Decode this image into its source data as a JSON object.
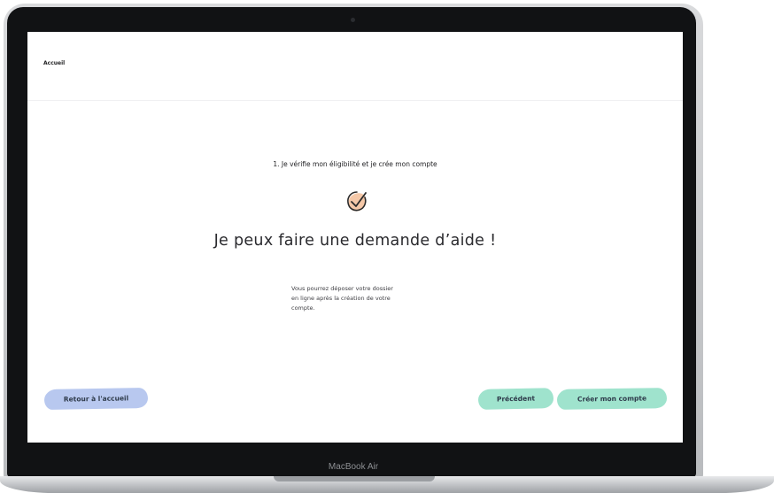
{
  "device": {
    "model_label": "MacBook Air"
  },
  "header": {
    "breadcrumb": "Accueil"
  },
  "step": {
    "label": "1. Je vérifie mon éligibilité et je crée mon compte"
  },
  "result": {
    "icon": "check-circle-icon",
    "headline": "Je peux faire une demande d’aide !",
    "description_lines": [
      "Vous pourrez déposer votre dossier",
      "en ligne après la création de votre",
      "compte."
    ]
  },
  "actions": {
    "back_label": "Retour à l'accueil",
    "previous_label": "Précédent",
    "create_label": "Créer mon compte"
  },
  "colors": {
    "back_button": "#b8c8ef",
    "primary_buttons": "#9fe3cd",
    "check_badge": "#f5c8a8"
  }
}
